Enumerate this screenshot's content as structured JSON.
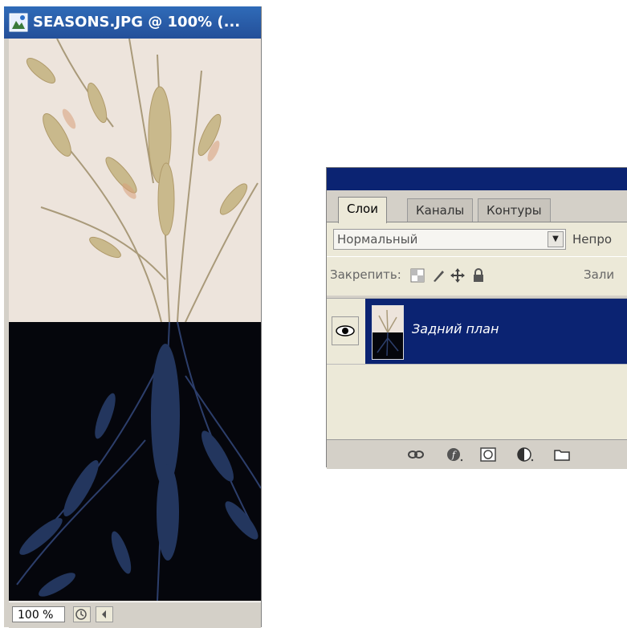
{
  "document": {
    "title": "SEASONS.JPG @ 100% (...",
    "zoom": "100 %"
  },
  "layers_panel": {
    "tabs": [
      {
        "label": "Слои",
        "active": true
      },
      {
        "label": "Каналы",
        "active": false
      },
      {
        "label": "Контуры",
        "active": false
      }
    ],
    "blend_mode": "Нормальный",
    "opacity_label": "Непро",
    "lock_label": "Закрепить:",
    "fill_label": "Зали",
    "layers": [
      {
        "name": "Задний план",
        "visible": true,
        "selected": true
      }
    ],
    "bottom_icons": [
      "link-icon",
      "layer-style-icon",
      "mask-icon",
      "adjustment-icon",
      "folder-icon"
    ]
  },
  "colors": {
    "panel_titlebar": "#0b2372",
    "selection": "#0b2372",
    "doc_title": "#2f6bb8"
  }
}
